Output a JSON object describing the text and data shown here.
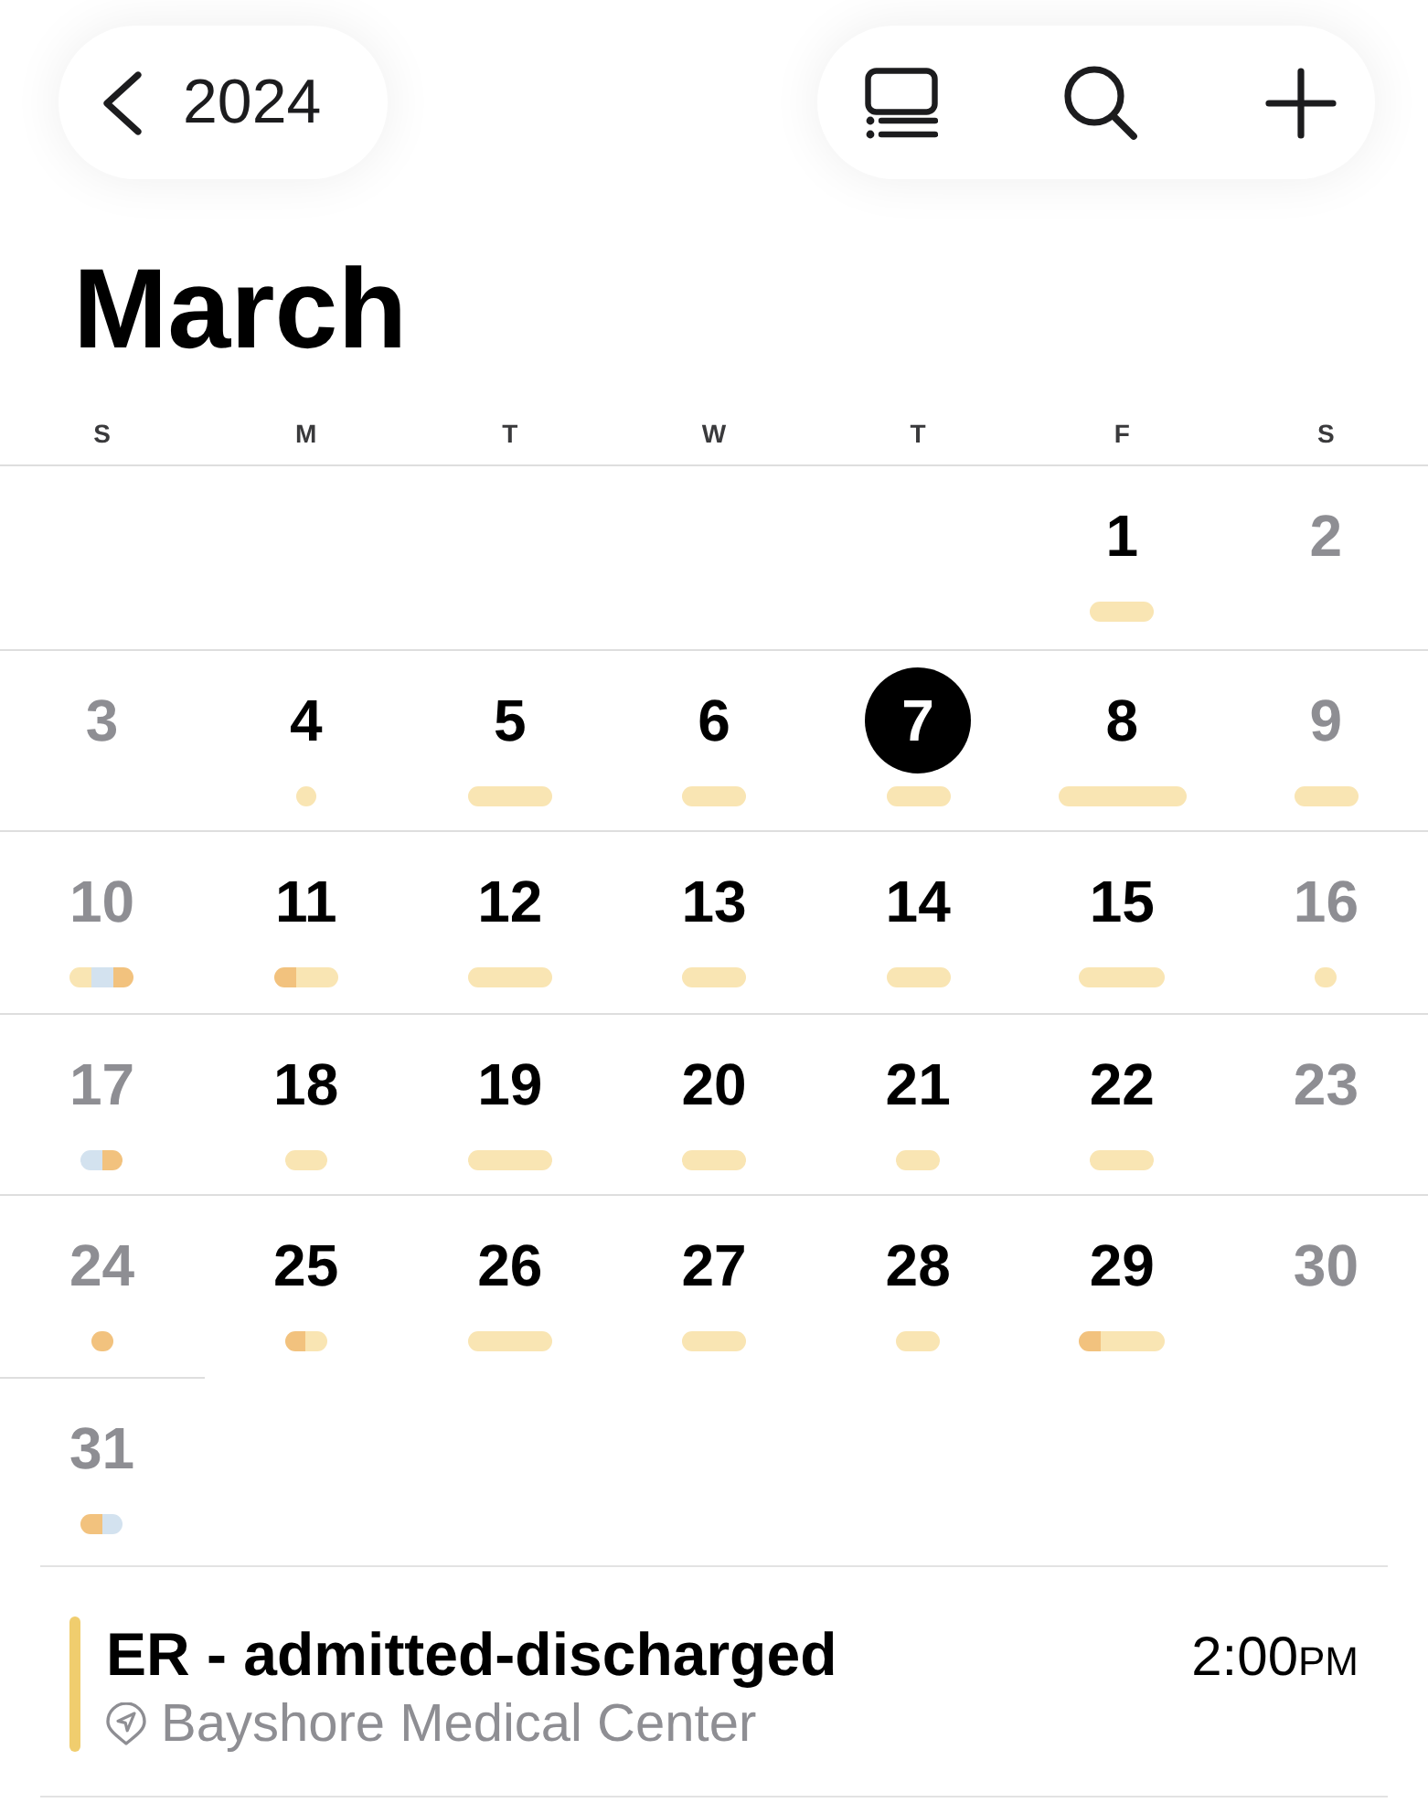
{
  "toolbar": {
    "back_label": "2024"
  },
  "month": {
    "title": "March"
  },
  "weekdays": [
    "S",
    "M",
    "T",
    "W",
    "T",
    "F",
    "S"
  ],
  "weeks": [
    {
      "days": [
        {
          "day": "1",
          "weekend": false,
          "today": false,
          "events": [
            {
              "color": "#f9e5b3"
            },
            {
              "color": "#f9e5b3"
            },
            {
              "color": "#f9e5b3"
            }
          ]
        },
        {
          "day": "2",
          "weekend": true,
          "today": false
        }
      ]
    },
    {
      "days": [
        {
          "day": "3",
          "weekend": true,
          "today": false
        },
        {
          "day": "4",
          "weekend": false,
          "today": false,
          "events": [
            {
              "color": "#f9e5b3"
            }
          ]
        },
        {
          "day": "5",
          "weekend": false,
          "today": false,
          "events": [
            {
              "color": "#f9e5b3"
            },
            {
              "color": "#f9e5b3"
            },
            {
              "color": "#f9e5b3"
            },
            {
              "color": "#f9e5b3"
            }
          ]
        },
        {
          "day": "6",
          "weekend": false,
          "today": false,
          "events": [
            {
              "color": "#f9e5b3"
            },
            {
              "color": "#f9e5b3"
            },
            {
              "color": "#f9e5b3"
            }
          ]
        },
        {
          "day": "7",
          "weekend": false,
          "today": true,
          "events": [
            {
              "color": "#f9e5b3"
            },
            {
              "color": "#f9e5b3"
            },
            {
              "color": "#f9e5b3"
            }
          ]
        },
        {
          "day": "8",
          "weekend": false,
          "today": false,
          "events": [
            {
              "color": "#f9e5b3"
            },
            {
              "color": "#f9e5b3"
            },
            {
              "color": "#f9e5b3"
            },
            {
              "color": "#f9e5b3"
            },
            {
              "color": "#f9e5b3"
            },
            {
              "color": "#f9e5b3"
            }
          ]
        },
        {
          "day": "9",
          "weekend": true,
          "today": false,
          "events": [
            {
              "color": "#f9e5b3"
            },
            {
              "color": "#f9e5b3"
            },
            {
              "color": "#f9e5b3"
            }
          ]
        }
      ]
    },
    {
      "days": [
        {
          "day": "10",
          "weekend": true,
          "today": false,
          "events": [
            {
              "color": "#f9e5b3"
            },
            {
              "color": "#d3e2ef"
            },
            {
              "color": "#f2c27e"
            }
          ]
        },
        {
          "day": "11",
          "weekend": false,
          "today": false,
          "events": [
            {
              "color": "#f2c27e"
            },
            {
              "color": "#f9e5b3"
            },
            {
              "color": "#f9e5b3"
            }
          ]
        },
        {
          "day": "12",
          "weekend": false,
          "today": false,
          "events": [
            {
              "color": "#f9e5b3"
            },
            {
              "color": "#f9e5b3"
            },
            {
              "color": "#f9e5b3"
            },
            {
              "color": "#f9e5b3"
            }
          ]
        },
        {
          "day": "13",
          "weekend": false,
          "today": false,
          "events": [
            {
              "color": "#f9e5b3"
            },
            {
              "color": "#f9e5b3"
            },
            {
              "color": "#f9e5b3"
            }
          ]
        },
        {
          "day": "14",
          "weekend": false,
          "today": false,
          "events": [
            {
              "color": "#f9e5b3"
            },
            {
              "color": "#f9e5b3"
            },
            {
              "color": "#f9e5b3"
            }
          ]
        },
        {
          "day": "15",
          "weekend": false,
          "today": false,
          "events": [
            {
              "color": "#f9e5b3"
            },
            {
              "color": "#f9e5b3"
            },
            {
              "color": "#f9e5b3"
            },
            {
              "color": "#f9e5b3"
            }
          ]
        },
        {
          "day": "16",
          "weekend": true,
          "today": false,
          "events": [
            {
              "color": "#f9e5b3"
            }
          ]
        }
      ]
    },
    {
      "days": [
        {
          "day": "17",
          "weekend": true,
          "today": false,
          "events": [
            {
              "color": "#d3e2ef"
            },
            {
              "color": "#f2c27e"
            }
          ]
        },
        {
          "day": "18",
          "weekend": false,
          "today": false,
          "events": [
            {
              "color": "#f9e5b3"
            },
            {
              "color": "#f9e5b3"
            }
          ]
        },
        {
          "day": "19",
          "weekend": false,
          "today": false,
          "events": [
            {
              "color": "#f9e5b3"
            },
            {
              "color": "#f9e5b3"
            },
            {
              "color": "#f9e5b3"
            },
            {
              "color": "#f9e5b3"
            }
          ]
        },
        {
          "day": "20",
          "weekend": false,
          "today": false,
          "events": [
            {
              "color": "#f9e5b3"
            },
            {
              "color": "#f9e5b3"
            },
            {
              "color": "#f9e5b3"
            }
          ]
        },
        {
          "day": "21",
          "weekend": false,
          "today": false,
          "events": [
            {
              "color": "#f9e5b3"
            },
            {
              "color": "#f9e5b3"
            }
          ]
        },
        {
          "day": "22",
          "weekend": false,
          "today": false,
          "events": [
            {
              "color": "#f9e5b3"
            },
            {
              "color": "#f9e5b3"
            },
            {
              "color": "#f9e5b3"
            }
          ]
        },
        {
          "day": "23",
          "weekend": true,
          "today": false
        }
      ]
    },
    {
      "days": [
        {
          "day": "24",
          "weekend": true,
          "today": false,
          "events": [
            {
              "color": "#f2c27e"
            }
          ]
        },
        {
          "day": "25",
          "weekend": false,
          "today": false,
          "events": [
            {
              "color": "#f2c27e"
            },
            {
              "color": "#f9e5b3"
            }
          ]
        },
        {
          "day": "26",
          "weekend": false,
          "today": false,
          "events": [
            {
              "color": "#f9e5b3"
            },
            {
              "color": "#f9e5b3"
            },
            {
              "color": "#f9e5b3"
            },
            {
              "color": "#f9e5b3"
            }
          ]
        },
        {
          "day": "27",
          "weekend": false,
          "today": false,
          "events": [
            {
              "color": "#f9e5b3"
            },
            {
              "color": "#f9e5b3"
            },
            {
              "color": "#f9e5b3"
            }
          ]
        },
        {
          "day": "28",
          "weekend": false,
          "today": false,
          "events": [
            {
              "color": "#f9e5b3"
            },
            {
              "color": "#f9e5b3"
            }
          ]
        },
        {
          "day": "29",
          "weekend": false,
          "today": false,
          "events": [
            {
              "color": "#f2c27e"
            },
            {
              "color": "#f9e5b3"
            },
            {
              "color": "#f9e5b3"
            },
            {
              "color": "#f9e5b3"
            }
          ]
        },
        {
          "day": "30",
          "weekend": true,
          "today": false
        }
      ]
    },
    {
      "days": [
        {
          "day": "31",
          "weekend": true,
          "today": false,
          "events": [
            {
              "color": "#f2c27e"
            },
            {
              "color": "#d3e2ef"
            }
          ]
        }
      ]
    }
  ],
  "event_list": [
    {
      "title": "ER - admitted-discharged",
      "location": "Bayshore Medical Center",
      "time": "2:00",
      "meridiem": "PM",
      "color": "#f0cd6e"
    }
  ]
}
